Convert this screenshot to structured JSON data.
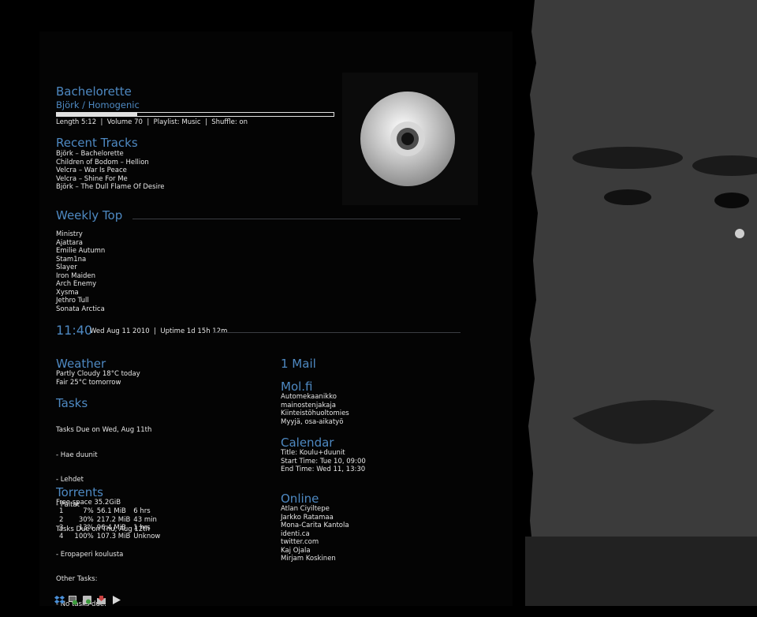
{
  "now_playing": {
    "title": "Bachelorette",
    "artist_album": "Björk  / Homogenic",
    "progress": 0.29,
    "info": "Length 5:12  |  Volume 70  |  Playlist: Music  |  Shuffle: on"
  },
  "recent": {
    "heading": "Recent Tracks",
    "items": [
      "Björk – Bachelorette",
      "Children of Bodom – Hellion",
      "Velcra – War Is Peace",
      "Velcra – Shine For Me",
      "Björk – The Dull Flame Of Desire"
    ]
  },
  "weekly": {
    "heading": "Weekly Top",
    "items": [
      "Ministry",
      "Ajattara",
      "Emilie Autumn",
      "Stam1na",
      "Slayer",
      "Iron Maiden",
      "Arch Enemy",
      "Xysma",
      "Jethro Tull",
      "Sonata Arctica"
    ]
  },
  "clock": {
    "time": "11:40",
    "info": "Wed Aug 11 2010  |  Uptime 1d 15h 12m"
  },
  "weather": {
    "heading": "Weather",
    "lines": [
      "Partly Cloudy 18°C today",
      "Fair 25°C tomorrow"
    ]
  },
  "tasks": {
    "heading": "Tasks",
    "lines": [
      "Tasks Due on Wed, Aug 11th",
      "    - Hae duunit",
      "    - Lehdet",
      "    - Paitat",
      "Tasks Due on Thu, Aug 12th",
      "    - Eropaperi koulusta",
      "Other Tasks:",
      "    - No tasks due."
    ]
  },
  "torrents": {
    "heading": "Torrents",
    "free_space": "Free space 35.2GiB",
    "rows": [
      [
        "1",
        "7%",
        "56.1 MiB",
        "6 hrs"
      ],
      [
        "2",
        "30%",
        "217.2 MiB",
        "43 min"
      ],
      [
        "3",
        "13%",
        "96.4 MiB",
        "1 hrs"
      ],
      [
        "4",
        "100%",
        "107.3 MiB",
        "Unknow"
      ]
    ]
  },
  "mail": {
    "heading": "1 Mail"
  },
  "molfi": {
    "heading": "Mol.fi",
    "items": [
      "Automekaanikko",
      "mainostenjakaja",
      "Kiinteistöhuoltomies",
      "Myyjä, osa-aikatyö"
    ]
  },
  "calendar": {
    "heading": "Calendar",
    "lines": [
      "Title: Koulu+duunit",
      "Start Time: Tue 10, 09:00",
      "End Time: Wed 11, 13:30"
    ]
  },
  "online": {
    "heading": "Online",
    "items": [
      "Atlan Ciyiltepe",
      "Jarkko Ratamaa",
      "Mona-Carita Kantola",
      "identi.ca",
      "twitter.com",
      "Kaj Ojala",
      "Mirjam Koskinen"
    ]
  },
  "icons": [
    "dropbox-icon",
    "network-monitor-icon",
    "system-monitor-icon",
    "download-icon",
    "play-icon"
  ]
}
